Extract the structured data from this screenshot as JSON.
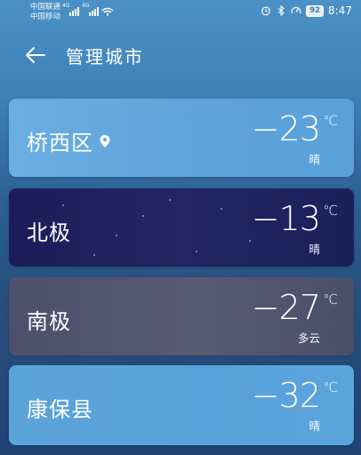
{
  "status_bar": {
    "carrier_1": "中国联通",
    "carrier_2": "中国移动",
    "net_1": "4G",
    "net_2": "4G",
    "battery": "92",
    "time": "8:47"
  },
  "header": {
    "title": "管理城市"
  },
  "cities": [
    {
      "name": "桥西区",
      "temp": "−23",
      "unit": "℃",
      "condition": "晴",
      "current_location": true
    },
    {
      "name": "北极",
      "temp": "−13",
      "unit": "℃",
      "condition": "晴"
    },
    {
      "name": "南极",
      "temp": "−27",
      "unit": "℃",
      "condition": "多云"
    },
    {
      "name": "康保县",
      "temp": "−32",
      "unit": "℃",
      "condition": "晴"
    }
  ],
  "colors": {
    "background": "#3f82b9",
    "card_sunny": "#5ea3db",
    "card_night": "#1f215e",
    "card_cloudy": "#55576f"
  }
}
